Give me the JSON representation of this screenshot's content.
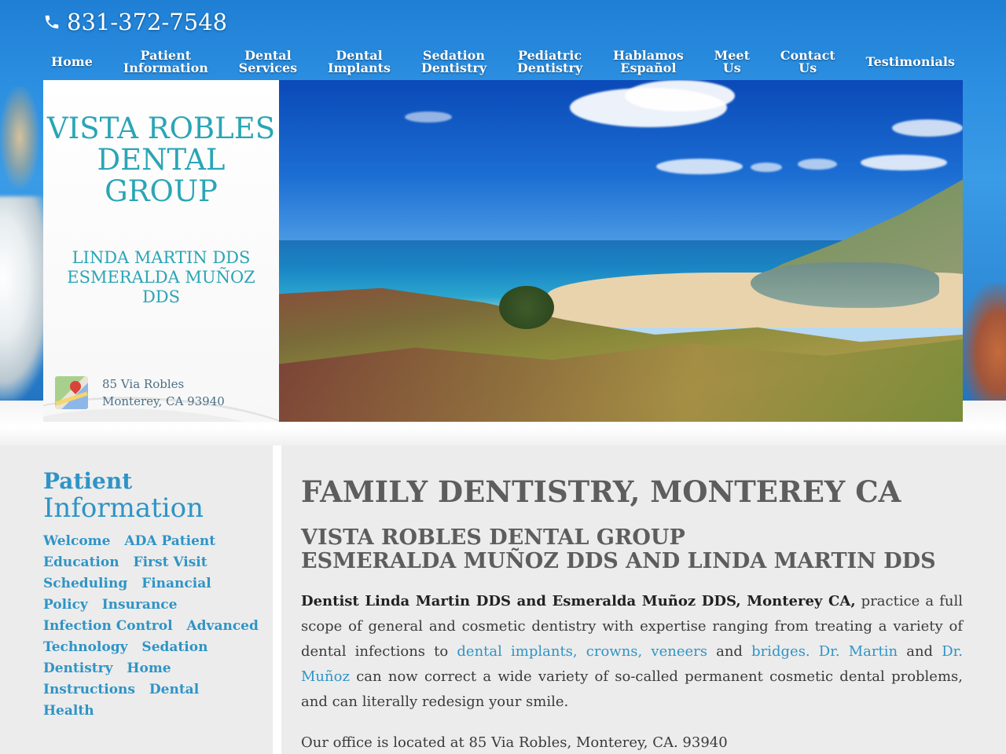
{
  "header": {
    "phone": "831-372-7548",
    "nav": [
      {
        "line1": "Home",
        "line2": ""
      },
      {
        "line1": "Patient",
        "line2": "Information"
      },
      {
        "line1": "Dental",
        "line2": "Services"
      },
      {
        "line1": "Dental",
        "line2": "Implants"
      },
      {
        "line1": "Sedation",
        "line2": "Dentistry"
      },
      {
        "line1": "Pediatric",
        "line2": "Dentistry"
      },
      {
        "line1": "Hablamos",
        "line2": "Español"
      },
      {
        "line1": "Meet",
        "line2": "Us"
      },
      {
        "line1": "Contact",
        "line2": "Us"
      },
      {
        "line1": "Testimonials",
        "line2": ""
      }
    ]
  },
  "logo": {
    "brand_lines": [
      "VISTA ROBLES",
      "DENTAL",
      "GROUP"
    ],
    "doctor_lines": [
      "LINDA MARTIN DDS",
      "ESMERALDA MUÑOZ",
      "DDS"
    ],
    "address_line1": "85 Via Robles",
    "address_line2": "Monterey, CA 93940"
  },
  "sidebar": {
    "title_bold": "Patient",
    "title_light": "Information",
    "links": [
      "Welcome",
      "ADA Patient Education",
      "First Visit",
      "Scheduling",
      "Financial Policy",
      "Insurance",
      "Infection Control",
      "Advanced Technology",
      "Sedation Dentistry",
      "Home Instructions",
      "Dental Health"
    ]
  },
  "main": {
    "heading": "FAMILY DENTISTRY, MONTEREY CA",
    "subheading_line1": "VISTA ROBLES DENTAL GROUP",
    "subheading_line2": "ESMERALDA MUÑOZ DDS AND LINDA MARTIN DDS",
    "para_bold": "Dentist Linda Martin DDS and Esmeralda Muñoz DDS, Monterey CA,",
    "para_t1": " practice a full scope of general and cosmetic dentistry with expertise ranging from treating a variety of dental infections to ",
    "para_link1": "dental implants, crowns, veneers",
    "para_t2": " and ",
    "para_link2": "bridges.",
    "para_t3": " ",
    "para_link3": "Dr. Martin",
    "para_t4": " and ",
    "para_link4": "Dr. Muñoz",
    "para_t5": " can now correct a wide variety of so-called permanent cosmetic dental problems, and can literally redesign your smile.",
    "office": "Our office is located at 85 Via Robles, Monterey, CA. 93940"
  },
  "colors": {
    "accent": "#2e94c6",
    "brand": "#2aa5b6",
    "heading": "#5d5d5d"
  }
}
